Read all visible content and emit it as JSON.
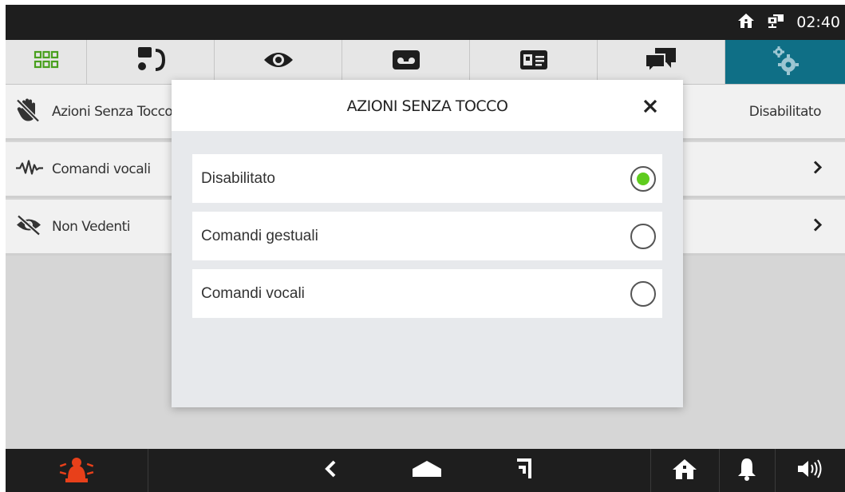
{
  "statusbar": {
    "time": "02:40",
    "icons": [
      "home-icon",
      "network-icon"
    ]
  },
  "tabs": [
    {
      "name": "apps-grid-icon",
      "active": false
    },
    {
      "name": "intercom-icon",
      "active": false
    },
    {
      "name": "eye-icon",
      "active": false
    },
    {
      "name": "voicemail-icon",
      "active": false
    },
    {
      "name": "contact-card-icon",
      "active": false
    },
    {
      "name": "chat-icon",
      "active": false
    },
    {
      "name": "settings-gear-icon",
      "active": true
    }
  ],
  "settings": {
    "items": [
      {
        "label": "Azioni Senza Tocco",
        "value": "Disabilitato",
        "icon": "no-touch-hand-icon"
      },
      {
        "label": "Comandi vocali",
        "icon": "voice-wave-icon",
        "chevron": true
      },
      {
        "label": "Non Vedenti",
        "icon": "eye-off-icon",
        "chevron": true
      }
    ]
  },
  "modal": {
    "title": "AZIONI SENZA TOCCO",
    "close_icon": "close-icon",
    "options": [
      {
        "label": "Disabilitato",
        "selected": true
      },
      {
        "label": "Comandi gestuali",
        "selected": false
      },
      {
        "label": "Comandi vocali",
        "selected": false
      }
    ]
  },
  "bottombar": {
    "icons": [
      "alarm-icon",
      "back-icon",
      "home-nav-icon",
      "recent-apps-icon",
      "home-icon",
      "bell-icon",
      "volume-icon"
    ]
  },
  "colors": {
    "accent": "#0f6f86",
    "radio_selected": "#5fcc1e",
    "grid_icon": "#49a01e",
    "alarm": "#e8401a"
  }
}
